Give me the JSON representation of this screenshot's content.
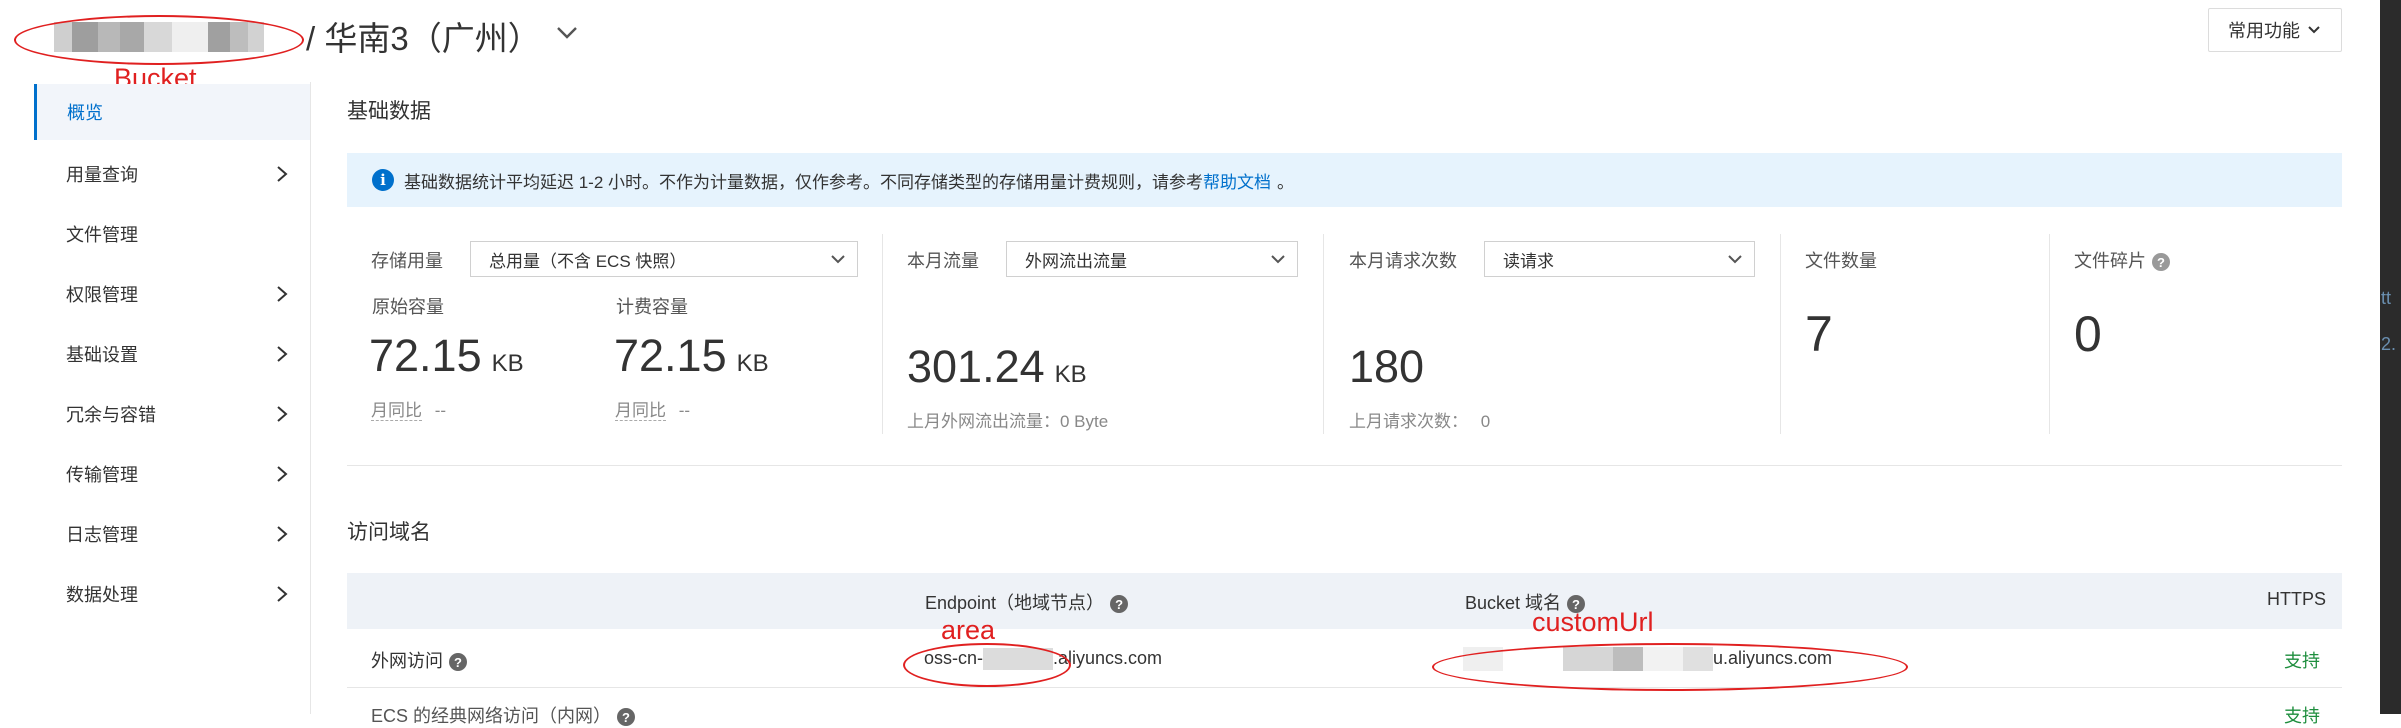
{
  "header": {
    "title": "/ 华南3（广州）",
    "common_label": "常用功能",
    "annotation": "Bucket"
  },
  "sidebar": {
    "items": [
      {
        "label": "概览",
        "has_chevron": false
      },
      {
        "label": "用量查询",
        "has_chevron": true
      },
      {
        "label": "文件管理",
        "has_chevron": false
      },
      {
        "label": "权限管理",
        "has_chevron": true
      },
      {
        "label": "基础设置",
        "has_chevron": true
      },
      {
        "label": "冗余与容错",
        "has_chevron": true
      },
      {
        "label": "传输管理",
        "has_chevron": true
      },
      {
        "label": "日志管理",
        "has_chevron": true
      },
      {
        "label": "数据处理",
        "has_chevron": true
      }
    ]
  },
  "basic": {
    "title": "基础数据",
    "notice_text": "基础数据统计平均延迟 1-2 小时。不作为计量数据，仅作参考。不同存储类型的存储用量计费规则，请参考",
    "notice_link": "帮助文档",
    "notice_end": "。",
    "storage": {
      "label": "存储用量",
      "select": "总用量（不含 ECS 快照）",
      "raw_label": "原始容量",
      "raw_value": "72.15",
      "raw_unit": "KB",
      "raw_mom": "月同比",
      "raw_mom_value": "--",
      "bill_label": "计费容量",
      "bill_value": "72.15",
      "bill_unit": "KB",
      "bill_mom": "月同比",
      "bill_mom_value": "--"
    },
    "traffic": {
      "label": "本月流量",
      "select": "外网流出流量",
      "value": "301.24",
      "unit": "KB",
      "last_month": "上月外网流出流量：0 Byte"
    },
    "requests": {
      "label": "本月请求次数",
      "select": "读请求",
      "value": "180",
      "last_month_label": "上月请求次数：",
      "last_month_value": "0"
    },
    "files": {
      "label": "文件数量",
      "value": "7"
    },
    "fragments": {
      "label": "文件碎片",
      "value": "0"
    }
  },
  "domain": {
    "title": "访问域名",
    "columns": {
      "endpoint": "Endpoint（地域节点）",
      "bucket_domain": "Bucket 域名",
      "https": "HTTPS"
    },
    "rows": [
      {
        "name": "外网访问",
        "endpoint_prefix": "oss-cn-",
        "endpoint_suffix": ".aliyuncs.com",
        "bucket_suffix": "u.aliyuncs.com",
        "https": "支持"
      },
      {
        "name": "ECS 的经典网络访问（内网）",
        "https": "支持"
      }
    ],
    "annotation_area": "area",
    "annotation_custom": "customUrl"
  },
  "right_edge": {
    "text1": "tt",
    "text2": "2."
  },
  "colors": {
    "accent": "#0070cc",
    "annotation_red": "#e02020",
    "success_green": "#1e8e3e",
    "notice_bg": "#e6f3fd"
  }
}
